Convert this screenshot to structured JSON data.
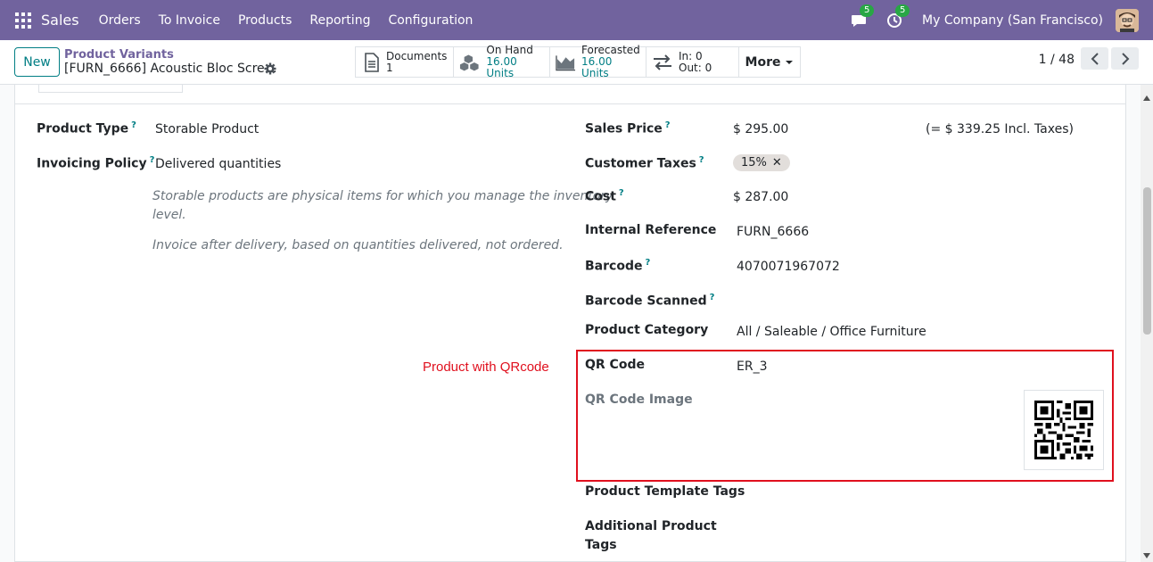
{
  "navbar": {
    "app_name": "Sales",
    "menu": [
      "Orders",
      "To Invoice",
      "Products",
      "Reporting",
      "Configuration"
    ],
    "messages_count": "5",
    "activities_count": "5",
    "company": "My Company (San Francisco)",
    "color": "#71639e"
  },
  "control": {
    "new_label": "New",
    "breadcrumb_parent": "Product Variants",
    "breadcrumb_current": "[FURN_6666] Acoustic Bloc Scre…",
    "smart_buttons": {
      "documents": {
        "label": "Documents",
        "value": "1"
      },
      "on_hand": {
        "label": "On Hand",
        "value": "16.00 Units"
      },
      "forecasted": {
        "label": "Forecasted",
        "value": "16.00 Units"
      },
      "in_out": {
        "in": "In: 0",
        "out": "Out: 0"
      },
      "more": "More"
    },
    "pager": "1 / 48"
  },
  "form": {
    "product_type_label": "Product Type",
    "product_type_value": "Storable Product",
    "invoicing_policy_label": "Invoicing Policy",
    "invoicing_policy_value": "Delivered quantities",
    "help_storable_1": "Storable products are physical items for which you manage the inventory",
    "help_storable_2": "level.",
    "help_invoice": "Invoice after delivery, based on quantities delivered, not ordered.",
    "sales_price_label": "Sales Price",
    "sales_price_value": "$ 295.00",
    "sales_price_incl": "(= $ 339.25 Incl. Taxes)",
    "customer_taxes_label": "Customer Taxes",
    "customer_taxes_tag": "15%",
    "cost_label": "Cost",
    "cost_value": "$ 287.00",
    "internal_ref_label": "Internal Reference",
    "internal_ref_value": "FURN_6666",
    "barcode_label": "Barcode",
    "barcode_value": "4070071967072",
    "barcode_scanned_label": "Barcode Scanned",
    "category_label": "Product Category",
    "category_value": "All / Saleable / Office Furniture",
    "qr_code_label": "QR Code",
    "qr_code_value": "ER_3",
    "qr_image_label": "QR Code Image",
    "template_tags_label": "Product Template Tags",
    "additional_tags_label_1": "Additional Product",
    "additional_tags_label_2": "Tags",
    "help_marker": "?"
  },
  "annotation": {
    "text": "Product with QRcode",
    "color": "#e0101e"
  }
}
